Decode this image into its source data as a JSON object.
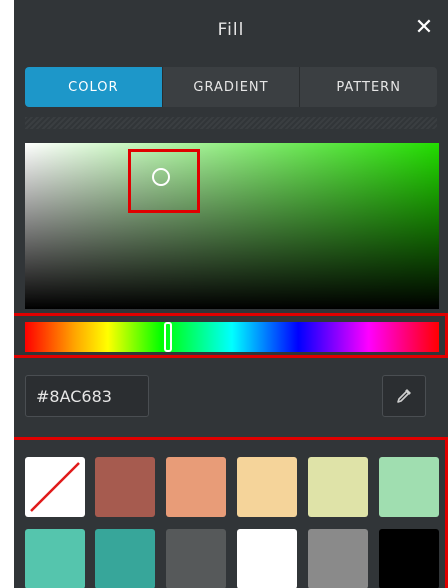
{
  "panel": {
    "title": "Fill",
    "close_symbol": "✕"
  },
  "tabs": [
    {
      "label": "COLOR",
      "active": true
    },
    {
      "label": "GRADIENT",
      "active": false
    },
    {
      "label": "PATTERN",
      "active": false
    }
  ],
  "color": {
    "hex_value": "#8AC683",
    "accent": "#1d97c9"
  },
  "icons": {
    "close": "close-icon",
    "eyedropper": "eyedropper-icon",
    "no_color": "no-color-swatch"
  },
  "swatches": [
    "none",
    "#a65b4f",
    "#e89c78",
    "#f5d49a",
    "#dfe3a8",
    "#a0deb0",
    "#55c5ad",
    "#37a69a",
    "#56595a",
    "#ffffff",
    "#8a8a8a",
    "#000000"
  ]
}
